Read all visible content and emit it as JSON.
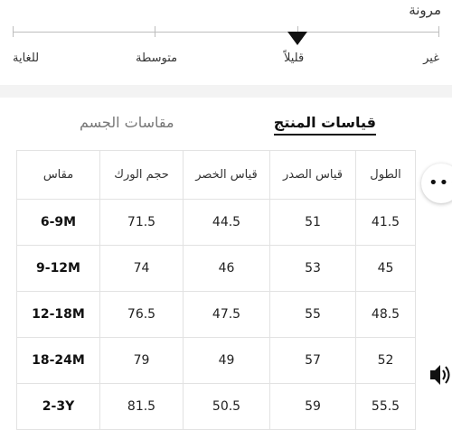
{
  "stretch": {
    "title": "مرونة",
    "levels": [
      "غير",
      "قليلاً",
      "متوسطة",
      "للغاية"
    ],
    "selected": "قليلاً"
  },
  "tabs": {
    "product": "قياسات المنتج",
    "body": "مقاسات الجسم",
    "active": "product"
  },
  "table": {
    "headers": {
      "length": "الطول",
      "chest": "قياس الصدر",
      "waist": "قياس الخصر",
      "hip": "حجم الورك",
      "size": "مقاس"
    },
    "rows": [
      {
        "length": "41.5",
        "chest": "51",
        "waist": "44.5",
        "hip": "71.5",
        "size": "6-9M"
      },
      {
        "length": "45",
        "chest": "53",
        "waist": "46",
        "hip": "74",
        "size": "9-12M"
      },
      {
        "length": "48.5",
        "chest": "55",
        "waist": "47.5",
        "hip": "76.5",
        "size": "12-18M"
      },
      {
        "length": "52",
        "chest": "57",
        "waist": "49",
        "hip": "79",
        "size": "18-24M"
      },
      {
        "length": "55.5",
        "chest": "59",
        "waist": "50.5",
        "hip": "81.5",
        "size": "2-3Y"
      }
    ]
  },
  "controls": {
    "more_icon": "more-horizontal-icon",
    "speaker_icon": "speaker-icon"
  }
}
